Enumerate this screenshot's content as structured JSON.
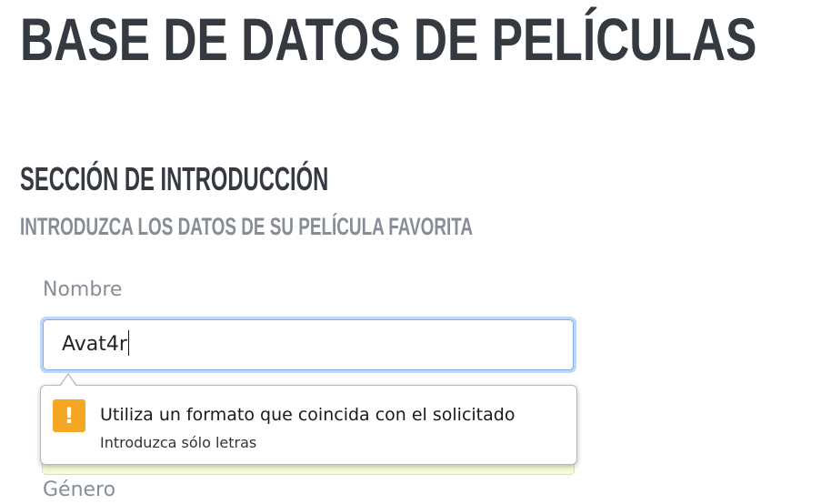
{
  "header": {
    "title": "BASE DE DATOS DE PELÍCULAS"
  },
  "section": {
    "title": "SECCIÓN DE INTRODUCCIÓN",
    "subtitle": "INTRODUZCA LOS DATOS DE SU PELÍCULA FAVORITA"
  },
  "form": {
    "nombre": {
      "label": "Nombre",
      "value": "Avat4r"
    },
    "hidden_label_fragment": "D  ~ · ·",
    "genero": {
      "label": "Género"
    }
  },
  "validation_tooltip": {
    "icon": "warning-icon",
    "icon_glyph": "!",
    "icon_color": "#f5a623",
    "title": "Utiliza un formato que coincida con el solicitado",
    "detail": "Introduzca sólo letras"
  },
  "colors": {
    "heading": "#343a40",
    "subheading": "#878d94",
    "focus_ring": "#bcd7f7",
    "invalid_field_bg": "#f8fbd6"
  }
}
